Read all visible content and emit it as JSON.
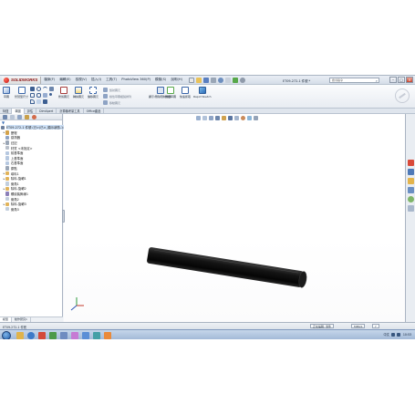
{
  "menubar": {
    "logo": "SOLIDWORKS",
    "menus": [
      "檔案(F)",
      "編輯(E)",
      "檢視(V)",
      "插入(I)",
      "工具(T)",
      "PhotoView 360(P)",
      "模擬(S)",
      "說明(H)"
    ],
    "doc_title": "ET09-272-1 件號 *",
    "search_placeholder": "搜尋指令"
  },
  "command_manager": {
    "tools": [
      {
        "label": "草圖"
      },
      {
        "label": "智慧型尺寸"
      },
      {
        "label": "修剪圖元"
      },
      {
        "label": "轉換圖元"
      },
      {
        "label": "偏移圖元"
      },
      {
        "label": "鏡射圖元"
      },
      {
        "label": "線性草圖複製排列"
      },
      {
        "label": "移動圖元"
      },
      {
        "label": "顯示/刪除限制條件"
      },
      {
        "label": "修復草圖"
      },
      {
        "label": "快速抓取"
      },
      {
        "label": "Rapid Sketch"
      }
    ],
    "side_texts": [
      "鏡射圖元",
      "線性草圖複製排列",
      "移動圖元"
    ]
  },
  "tabs": [
    "特徵",
    "草圖",
    "評估",
    "DimXpert",
    "計算機考量工具",
    "Office產品"
  ],
  "active_tab": "草圖",
  "tree": [
    {
      "label": "ET09-272-1 件號 (已>(已>_顯示狀態-1>)",
      "exp": ""
    },
    {
      "label": "歷程",
      "exp": "▸"
    },
    {
      "label": "感測器",
      "exp": ""
    },
    {
      "label": "註記",
      "exp": "▸"
    },
    {
      "label": "材質 <未指定>",
      "exp": ""
    },
    {
      "label": "前基準面",
      "exp": ""
    },
    {
      "label": "上基準面",
      "exp": ""
    },
    {
      "label": "右基準面",
      "exp": ""
    },
    {
      "label": "原點",
      "exp": ""
    },
    {
      "label": "填料1",
      "exp": "▸"
    },
    {
      "label": "除料-旋轉1",
      "exp": "▸"
    },
    {
      "label": "倒角1",
      "exp": ""
    },
    {
      "label": "除料-旋轉2",
      "exp": "▸"
    },
    {
      "label": "螺紋裝飾線1",
      "exp": ""
    },
    {
      "label": "倒角2",
      "exp": ""
    },
    {
      "label": "除料-旋轉3",
      "exp": "▸"
    },
    {
      "label": "倒角3",
      "exp": ""
    }
  ],
  "panel_tabs": [
    "模型",
    "動作研究1"
  ],
  "status": {
    "left": "ET09-272-1 件號",
    "box1": "正在編輯: 零件",
    "box2": "MMGS",
    "box3": "?"
  },
  "taskbar": {
    "lang": "中文",
    "time": "10:53"
  }
}
